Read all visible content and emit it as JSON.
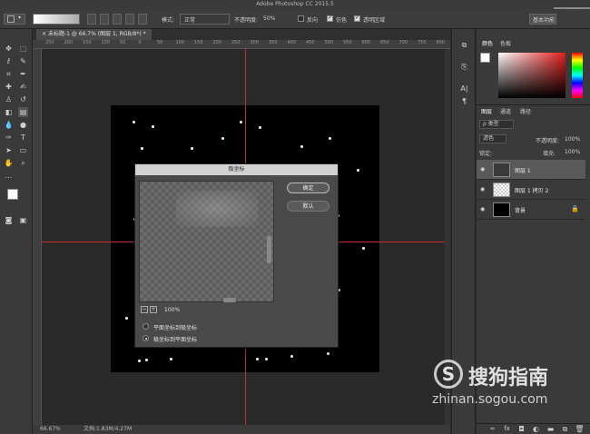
{
  "app": {
    "title": "Adobe Photoshop CC 2015.5",
    "ime_indicator": "中文"
  },
  "options_bar": {
    "mode_label": "模式:",
    "mode_value": "正常",
    "opacity_label": "不透明度:",
    "opacity_value": "50%",
    "reverse_label": "反向",
    "dither_label": "仿色",
    "transparency_label": "透明区域",
    "reverse_checked": false,
    "dither_checked": true,
    "transparency_checked": true,
    "workspace_button": "基本功能"
  },
  "document_tab": {
    "title": "未标题-1 @ 66.7% (图层 1, RGB/8*) *",
    "close_glyph": "×"
  },
  "ruler": {
    "top_ticks": [
      "250",
      "200",
      "150",
      "100",
      "50",
      "0",
      "50",
      "100",
      "150",
      "200",
      "250",
      "300",
      "350",
      "400",
      "450",
      "500",
      "550",
      "600",
      "650",
      "700",
      "750",
      "800"
    ]
  },
  "status_bar": {
    "zoom": "66.67%",
    "doc_info": "文档:1.83M/4.27M"
  },
  "dialog": {
    "title": "极坐标",
    "ok_label": "确定",
    "default_label": "默认",
    "zoom_value": "100%",
    "zoom_out_glyph": "−",
    "zoom_in_glyph": "+",
    "option_rect_to_polar": "平面坐标到极坐标",
    "option_polar_to_rect": "极坐标到平面坐标",
    "selected_option": "polar_to_rect"
  },
  "color_panel": {
    "tab_color": "颜色",
    "tab_swatches": "色板",
    "accent": "#e21c1c"
  },
  "layers_panel": {
    "tabs": [
      "图层",
      "通道",
      "路径"
    ],
    "filter_kind": "ρ 类型",
    "blend_mode": "滤色",
    "opacity_label": "不透明度:",
    "opacity_value": "100%",
    "lock_label": "锁定:",
    "fill_label": "填充:",
    "fill_value": "100%",
    "layers": [
      {
        "name": "图层 1",
        "selected": true
      },
      {
        "name": "图层 1 拷贝 2",
        "selected": false
      },
      {
        "name": "背景",
        "selected": false
      }
    ],
    "bottom_icons": [
      "link-icon",
      "fx-icon",
      "mask-icon",
      "adjustment-icon",
      "group-icon",
      "new-layer-icon",
      "trash-icon"
    ]
  },
  "watermark": {
    "brand": "搜狗指南",
    "url": "zhinan.sogou.com",
    "logo_letter": "S"
  }
}
